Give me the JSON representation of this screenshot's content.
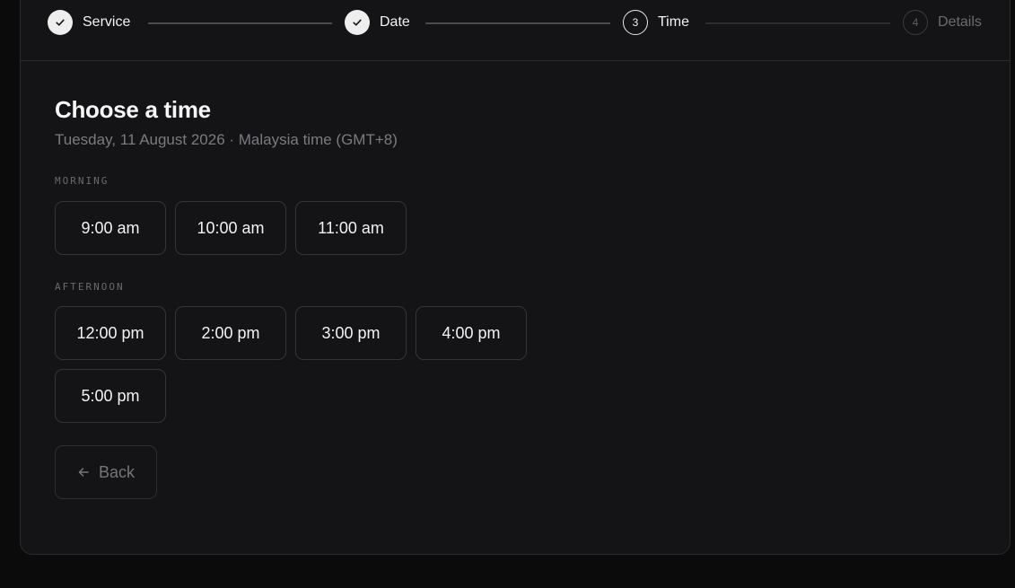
{
  "stepper": {
    "steps": [
      {
        "label": "Service",
        "state": "done",
        "number": ""
      },
      {
        "label": "Date",
        "state": "done",
        "number": ""
      },
      {
        "label": "Time",
        "state": "current",
        "number": "3"
      },
      {
        "label": "Details",
        "state": "todo",
        "number": "4"
      }
    ]
  },
  "main": {
    "title": "Choose a time",
    "subtitle": "Tuesday, 11 August 2026 · Malaysia time (GMT+8)",
    "morning": {
      "label": "MORNING",
      "slots": [
        "9:00 am",
        "10:00 am",
        "11:00 am"
      ]
    },
    "afternoon": {
      "label": "AFTERNOON",
      "slots": [
        "12:00 pm",
        "2:00 pm",
        "3:00 pm",
        "4:00 pm",
        "5:00 pm"
      ]
    },
    "back_label": "Back"
  },
  "icons": {
    "done": "check-icon",
    "back": "arrow-left-icon"
  },
  "colors": {
    "background": "#0b0b0c",
    "card": "#141416",
    "border": "#2a2a2e",
    "text": "#f2f2f3",
    "muted": "#7a7a81"
  }
}
